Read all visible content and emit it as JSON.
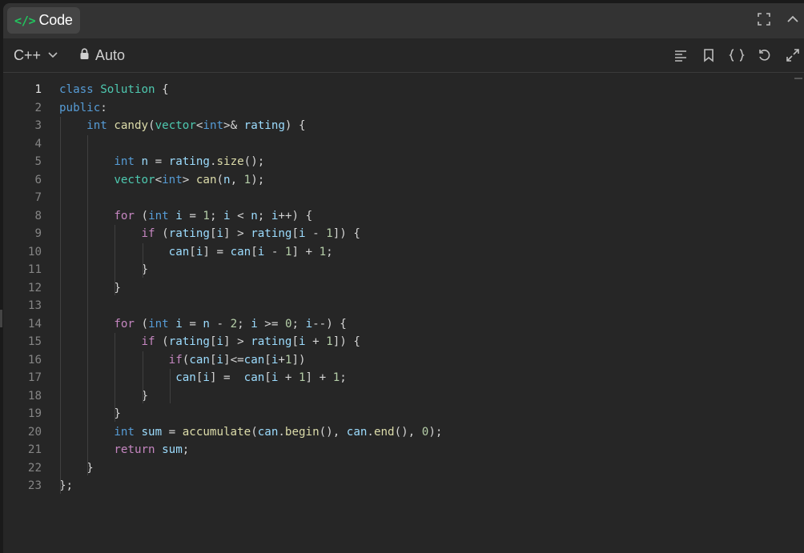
{
  "header": {
    "tab_label": "Code",
    "tab_icon": "code-icon"
  },
  "toolbar": {
    "language": "C++",
    "mode": "Auto"
  },
  "icons": {
    "title_actions": [
      "fullscreen-icon",
      "collapse-icon"
    ],
    "tool_actions": [
      "format-icon",
      "bookmark-icon",
      "braces-icon",
      "reset-icon",
      "expand-icon"
    ]
  },
  "colors": {
    "accent": "#22c55e",
    "keyword": "#569cd6",
    "control": "#c586c0",
    "type": "#4ec9b0",
    "function": "#dcdcaa",
    "variable": "#9cdcfe",
    "number": "#b5cea8"
  },
  "editor": {
    "active_line": 1,
    "lines": [
      [
        [
          "kw",
          "class"
        ],
        [
          "op",
          " "
        ],
        [
          "typ",
          "Solution"
        ],
        [
          "op",
          " {"
        ]
      ],
      [
        [
          "kw",
          "public"
        ],
        [
          "op",
          ":"
        ]
      ],
      [
        [
          "op",
          "    "
        ],
        [
          "kw",
          "int"
        ],
        [
          "op",
          " "
        ],
        [
          "fn",
          "candy"
        ],
        [
          "op",
          "("
        ],
        [
          "typ",
          "vector"
        ],
        [
          "op",
          "<"
        ],
        [
          "kw",
          "int"
        ],
        [
          "op",
          ">& "
        ],
        [
          "var",
          "rating"
        ],
        [
          "op",
          ") {"
        ]
      ],
      [],
      [
        [
          "op",
          "        "
        ],
        [
          "kw",
          "int"
        ],
        [
          "op",
          " "
        ],
        [
          "var",
          "n"
        ],
        [
          "op",
          " = "
        ],
        [
          "var",
          "rating"
        ],
        [
          "op",
          "."
        ],
        [
          "fn",
          "size"
        ],
        [
          "op",
          "();"
        ]
      ],
      [
        [
          "op",
          "        "
        ],
        [
          "typ",
          "vector"
        ],
        [
          "op",
          "<"
        ],
        [
          "kw",
          "int"
        ],
        [
          "op",
          "> "
        ],
        [
          "fn",
          "can"
        ],
        [
          "op",
          "("
        ],
        [
          "var",
          "n"
        ],
        [
          "op",
          ", "
        ],
        [
          "num",
          "1"
        ],
        [
          "op",
          ");"
        ]
      ],
      [],
      [
        [
          "op",
          "        "
        ],
        [
          "ctl",
          "for"
        ],
        [
          "op",
          " ("
        ],
        [
          "kw",
          "int"
        ],
        [
          "op",
          " "
        ],
        [
          "var",
          "i"
        ],
        [
          "op",
          " = "
        ],
        [
          "num",
          "1"
        ],
        [
          "op",
          "; "
        ],
        [
          "var",
          "i"
        ],
        [
          "op",
          " < "
        ],
        [
          "var",
          "n"
        ],
        [
          "op",
          "; "
        ],
        [
          "var",
          "i"
        ],
        [
          "op",
          "++) {"
        ]
      ],
      [
        [
          "op",
          "            "
        ],
        [
          "ctl",
          "if"
        ],
        [
          "op",
          " ("
        ],
        [
          "var",
          "rating"
        ],
        [
          "op",
          "["
        ],
        [
          "var",
          "i"
        ],
        [
          "op",
          "] > "
        ],
        [
          "var",
          "rating"
        ],
        [
          "op",
          "["
        ],
        [
          "var",
          "i"
        ],
        [
          "op",
          " - "
        ],
        [
          "num",
          "1"
        ],
        [
          "op",
          "]) {"
        ]
      ],
      [
        [
          "op",
          "                "
        ],
        [
          "var",
          "can"
        ],
        [
          "op",
          "["
        ],
        [
          "var",
          "i"
        ],
        [
          "op",
          "] = "
        ],
        [
          "var",
          "can"
        ],
        [
          "op",
          "["
        ],
        [
          "var",
          "i"
        ],
        [
          "op",
          " - "
        ],
        [
          "num",
          "1"
        ],
        [
          "op",
          "] + "
        ],
        [
          "num",
          "1"
        ],
        [
          "op",
          ";"
        ]
      ],
      [
        [
          "op",
          "            }"
        ]
      ],
      [
        [
          "op",
          "        }"
        ]
      ],
      [],
      [
        [
          "op",
          "        "
        ],
        [
          "ctl",
          "for"
        ],
        [
          "op",
          " ("
        ],
        [
          "kw",
          "int"
        ],
        [
          "op",
          " "
        ],
        [
          "var",
          "i"
        ],
        [
          "op",
          " = "
        ],
        [
          "var",
          "n"
        ],
        [
          "op",
          " - "
        ],
        [
          "num",
          "2"
        ],
        [
          "op",
          "; "
        ],
        [
          "var",
          "i"
        ],
        [
          "op",
          " >= "
        ],
        [
          "num",
          "0"
        ],
        [
          "op",
          "; "
        ],
        [
          "var",
          "i"
        ],
        [
          "op",
          "--) {"
        ]
      ],
      [
        [
          "op",
          "            "
        ],
        [
          "ctl",
          "if"
        ],
        [
          "op",
          " ("
        ],
        [
          "var",
          "rating"
        ],
        [
          "op",
          "["
        ],
        [
          "var",
          "i"
        ],
        [
          "op",
          "] > "
        ],
        [
          "var",
          "rating"
        ],
        [
          "op",
          "["
        ],
        [
          "var",
          "i"
        ],
        [
          "op",
          " + "
        ],
        [
          "num",
          "1"
        ],
        [
          "op",
          "]) {"
        ]
      ],
      [
        [
          "op",
          "                "
        ],
        [
          "ctl",
          "if"
        ],
        [
          "op",
          "("
        ],
        [
          "var",
          "can"
        ],
        [
          "op",
          "["
        ],
        [
          "var",
          "i"
        ],
        [
          "op",
          "]<="
        ],
        [
          "var",
          "can"
        ],
        [
          "op",
          "["
        ],
        [
          "var",
          "i"
        ],
        [
          "op",
          "+"
        ],
        [
          "num",
          "1"
        ],
        [
          "op",
          "])"
        ]
      ],
      [
        [
          "op",
          "                 "
        ],
        [
          "var",
          "can"
        ],
        [
          "op",
          "["
        ],
        [
          "var",
          "i"
        ],
        [
          "op",
          "] =  "
        ],
        [
          "var",
          "can"
        ],
        [
          "op",
          "["
        ],
        [
          "var",
          "i"
        ],
        [
          "op",
          " + "
        ],
        [
          "num",
          "1"
        ],
        [
          "op",
          "] + "
        ],
        [
          "num",
          "1"
        ],
        [
          "op",
          ";"
        ]
      ],
      [
        [
          "op",
          "            }"
        ]
      ],
      [
        [
          "op",
          "        }"
        ]
      ],
      [
        [
          "op",
          "        "
        ],
        [
          "kw",
          "int"
        ],
        [
          "op",
          " "
        ],
        [
          "var",
          "sum"
        ],
        [
          "op",
          " = "
        ],
        [
          "fn",
          "accumulate"
        ],
        [
          "op",
          "("
        ],
        [
          "var",
          "can"
        ],
        [
          "op",
          "."
        ],
        [
          "fn",
          "begin"
        ],
        [
          "op",
          "(), "
        ],
        [
          "var",
          "can"
        ],
        [
          "op",
          "."
        ],
        [
          "fn",
          "end"
        ],
        [
          "op",
          "(), "
        ],
        [
          "num",
          "0"
        ],
        [
          "op",
          ");"
        ]
      ],
      [
        [
          "op",
          "        "
        ],
        [
          "ctl",
          "return"
        ],
        [
          "op",
          " "
        ],
        [
          "var",
          "sum"
        ],
        [
          "op",
          ";"
        ]
      ],
      [
        [
          "op",
          "    }"
        ]
      ],
      [
        [
          "op",
          "};"
        ]
      ]
    ]
  }
}
